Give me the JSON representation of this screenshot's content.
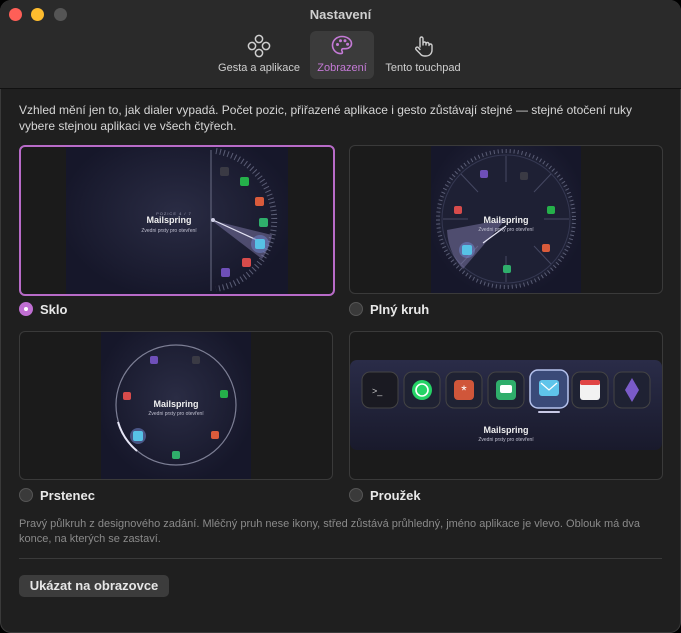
{
  "window": {
    "title": "Nastavení"
  },
  "toolbar": {
    "items": [
      {
        "label": "Gesta a aplikace",
        "icon": "gesture-dots-icon"
      },
      {
        "label": "Zobrazení",
        "icon": "palette-icon",
        "selected": true
      },
      {
        "label": "Tento touchpad",
        "icon": "hand-pointer-icon"
      }
    ]
  },
  "description": "Vzhled mění jen to, jak dialer vypadá. Počet pozic, přiřazené aplikace i gesto zůstávají stejné — stejné otočení ruky vybere stejnou aplikaci ve všech čtyřech.",
  "preview": {
    "app_name": "Mailspring",
    "hint": "Zvedni prsty pro otevření",
    "glass_caption": "POZICE 4 / 7"
  },
  "styles": [
    {
      "label": "Sklo",
      "selected": true
    },
    {
      "label": "Plný kruh",
      "selected": false
    },
    {
      "label": "Prstenec",
      "selected": false
    },
    {
      "label": "Proužek",
      "selected": false
    }
  ],
  "note": "Pravý půlkruh z designového zadání. Mléčný pruh nese ikony, střed zůstává průhledný, jméno aplikace je vlevo. Oblouk má dva konce, na kterých se zastaví.",
  "show_button": "Ukázat na obrazovce",
  "colors": {
    "accent": "#c06fd2",
    "background": "#1f1f1f"
  }
}
